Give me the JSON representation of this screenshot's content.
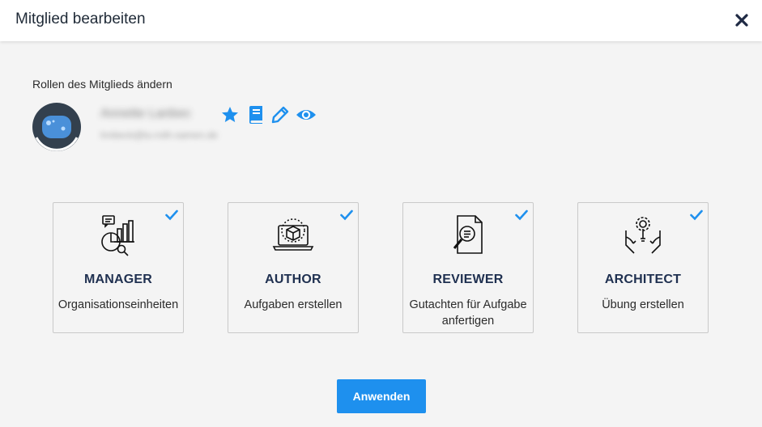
{
  "dialog": {
    "title": "Mitglied bearbeiten"
  },
  "section": {
    "label": "Rollen des Mitglieds ändern"
  },
  "member": {
    "name": "Annette Lanbec",
    "email": "lnnbeck@tu-roth-samen.de",
    "icons": [
      "star-icon",
      "book-icon",
      "pencil-icon",
      "eye-icon"
    ]
  },
  "roles": [
    {
      "title": "MANAGER",
      "description": "Organisationseinheiten",
      "checked": true,
      "icon": "manager-chart-icon"
    },
    {
      "title": "AUTHOR",
      "description": "Aufgaben erstellen",
      "checked": true,
      "icon": "author-laptop-icon"
    },
    {
      "title": "REVIEWER",
      "description": "Gutachten für Aufgabe anfertigen",
      "checked": true,
      "icon": "reviewer-document-icon"
    },
    {
      "title": "ARCHITECT",
      "description": "Übung erstellen",
      "checked": true,
      "icon": "architect-hands-bulb-icon"
    }
  ],
  "actions": {
    "apply_label": "Anwenden"
  },
  "colors": {
    "accent": "#1e90ee",
    "title": "#1f3050",
    "background": "#f4f4f4"
  }
}
